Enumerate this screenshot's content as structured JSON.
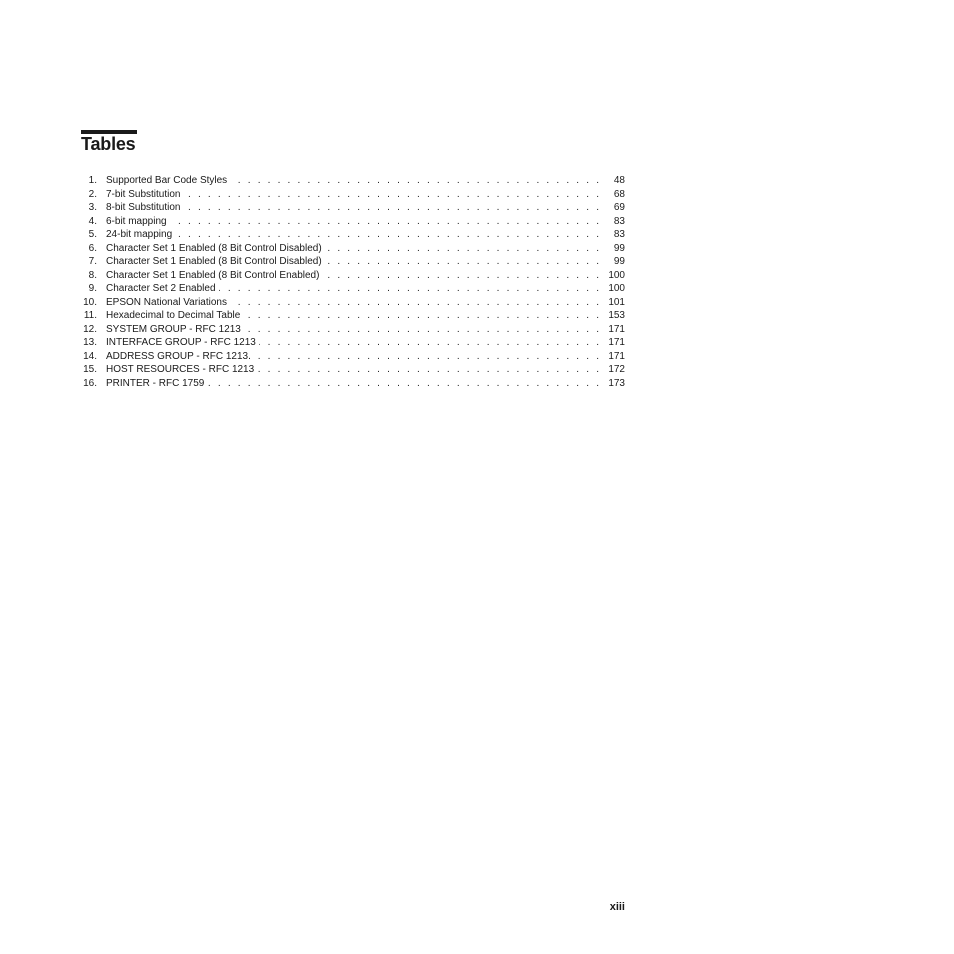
{
  "heading": {
    "title": "Tables"
  },
  "entries": [
    {
      "num": "1.",
      "label": "Supported Bar Code Styles",
      "page": "48"
    },
    {
      "num": "2.",
      "label": "7-bit Substitution",
      "page": "68"
    },
    {
      "num": "3.",
      "label": "8-bit Substitution",
      "page": "69"
    },
    {
      "num": "4.",
      "label": "6-bit mapping",
      "page": "83"
    },
    {
      "num": "5.",
      "label": "24-bit mapping",
      "page": "83"
    },
    {
      "num": "6.",
      "label": "Character Set 1 Enabled (8 Bit Control Disabled)",
      "page": "99"
    },
    {
      "num": "7.",
      "label": "Character Set 1 Enabled (8 Bit Control Disabled)",
      "page": "99"
    },
    {
      "num": "8.",
      "label": "Character Set 1 Enabled (8 Bit Control Enabled)",
      "page": "100"
    },
    {
      "num": "9.",
      "label": "Character Set 2 Enabled",
      "page": "100"
    },
    {
      "num": "10.",
      "label": "EPSON National Variations",
      "page": "101"
    },
    {
      "num": "11.",
      "label": "Hexadecimal to Decimal Table",
      "page": "153"
    },
    {
      "num": "12.",
      "label": "SYSTEM GROUP - RFC 1213",
      "page": "171"
    },
    {
      "num": "13.",
      "label": "INTERFACE GROUP - RFC 1213",
      "page": "171"
    },
    {
      "num": "14.",
      "label": "ADDRESS GROUP - RFC 1213.",
      "page": "171"
    },
    {
      "num": "15.",
      "label": "HOST RESOURCES - RFC 1213",
      "page": "172"
    },
    {
      "num": "16.",
      "label": "PRINTER - RFC 1759",
      "page": "173"
    }
  ],
  "footer": {
    "page_number": "xiii"
  }
}
